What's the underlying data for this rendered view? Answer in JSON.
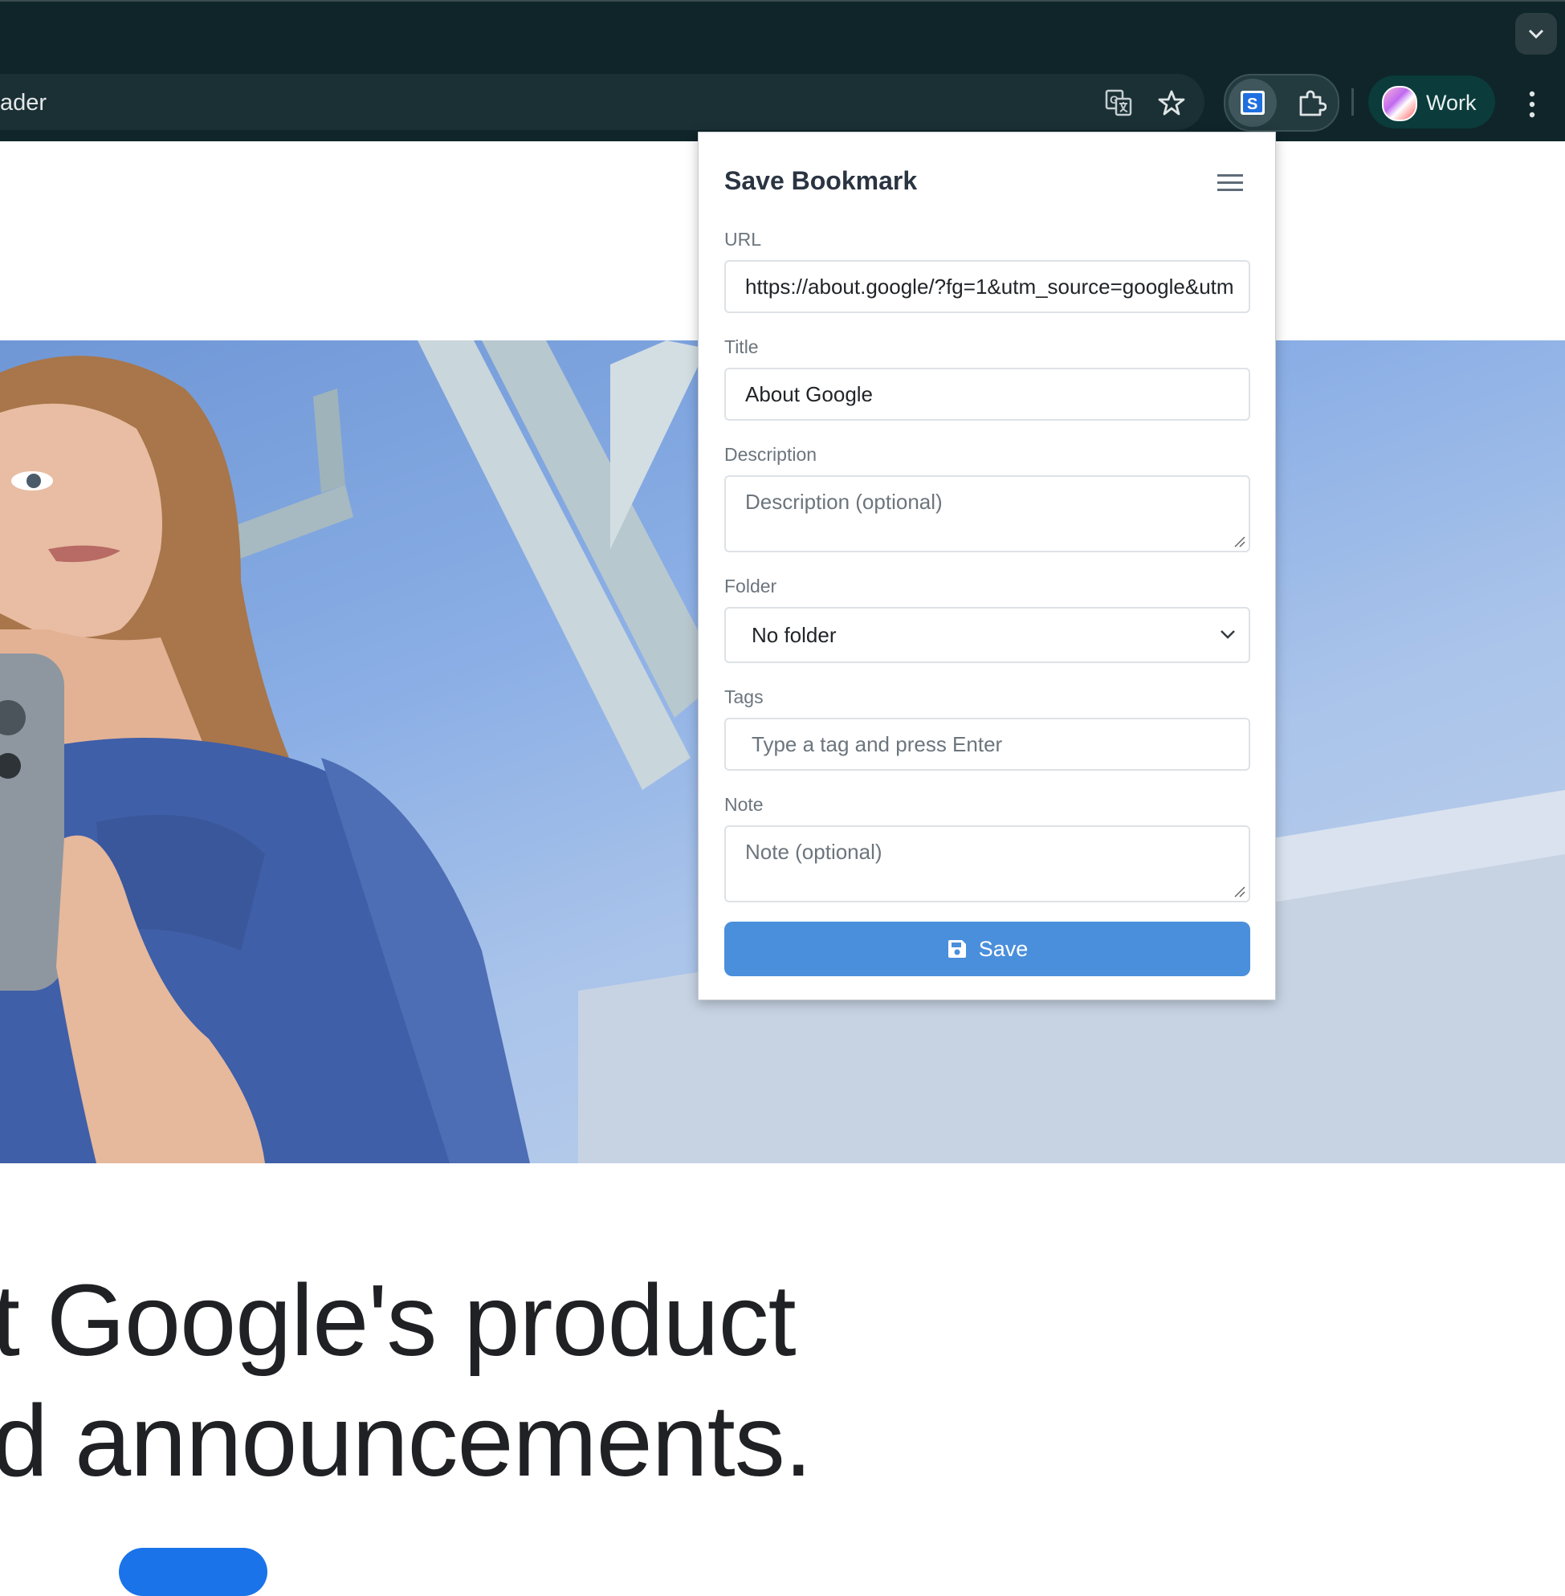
{
  "browser": {
    "omnibox_text": "ader",
    "profile_label": "Work",
    "icons": [
      "chevron-down-icon",
      "translate-icon",
      "star-icon",
      "bookmark-extension-icon",
      "puzzle-icon",
      "more-vert-icon"
    ]
  },
  "page": {
    "headline_line1": "t Google's product",
    "headline_line2": "d announcements."
  },
  "popup": {
    "title": "Save Bookmark",
    "url_label": "URL",
    "url_value": "https://about.google/?fg=1&utm_source=google&utm",
    "title_label": "Title",
    "title_value": "About Google",
    "description_label": "Description",
    "description_placeholder": "Description (optional)",
    "folder_label": "Folder",
    "folder_value": "No folder",
    "tags_label": "Tags",
    "tags_placeholder": "Type a tag and press Enter",
    "note_label": "Note",
    "note_placeholder": "Note (optional)",
    "save_label": "Save"
  },
  "colors": {
    "chrome_bg": "#0f2529",
    "save_button": "#4a8fdb",
    "title_text": "#2a3442"
  }
}
